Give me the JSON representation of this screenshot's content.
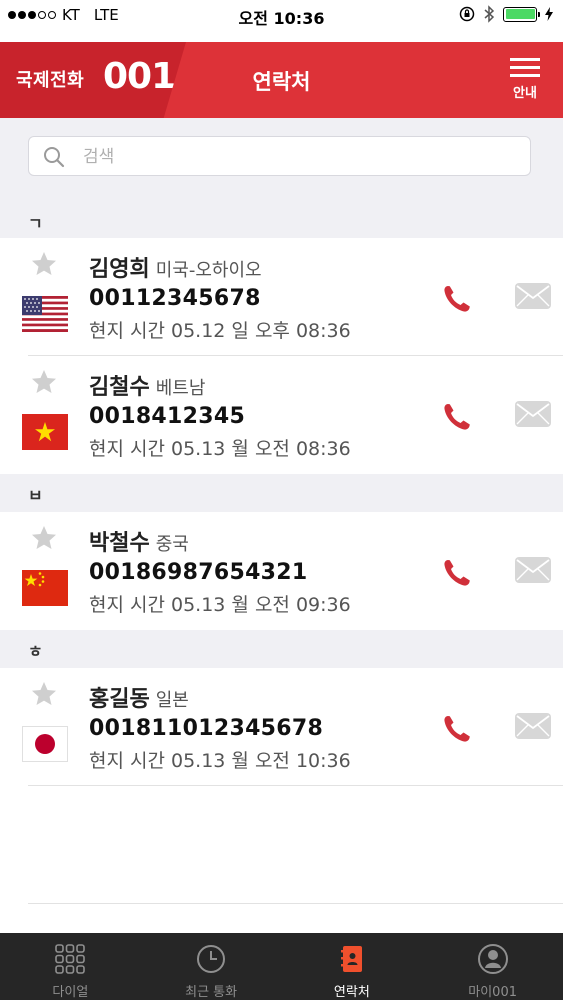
{
  "status_bar": {
    "carrier": "KT",
    "network": "LTE",
    "time": "오전 10:36"
  },
  "header": {
    "brand_text": "국제전화",
    "brand_number": "001",
    "title": "연락처",
    "menu_label": "안내"
  },
  "search": {
    "placeholder": "검색"
  },
  "sections": [
    {
      "label": "ㄱ"
    },
    {
      "label": "ㅂ"
    },
    {
      "label": "ㅎ"
    }
  ],
  "contacts": [
    {
      "name": "김영희",
      "country": "미국-오하이오",
      "number": "00112345678",
      "local_time": "현지 시간 05.12 일 오후 08:36",
      "flag": "usa-flag"
    },
    {
      "name": "김철수",
      "country": "베트남",
      "number": "0018412345",
      "local_time": "현지 시간 05.13 월 오전 08:36",
      "flag": "vietnam-flag"
    },
    {
      "name": "박철수",
      "country": "중국",
      "number": "00186987654321",
      "local_time": "현지 시간 05.13 월 오전 09:36",
      "flag": "china-flag"
    },
    {
      "name": "홍길동",
      "country": "일본",
      "number": "001811012345678",
      "local_time": "현지 시간 05.13 월 오전 10:36",
      "flag": "japan-flag"
    }
  ],
  "tabs": [
    {
      "label": "다이얼",
      "icon": "dialpad-icon",
      "active": false
    },
    {
      "label": "최근 통화",
      "icon": "clock-icon",
      "active": false
    },
    {
      "label": "연락처",
      "icon": "contacts-book-icon",
      "active": true
    },
    {
      "label": "마이001",
      "icon": "profile-icon",
      "active": false
    }
  ],
  "colors": {
    "header_red": "#dd3238",
    "brand_red": "#c8232c",
    "call_red": "#d0303a",
    "active_tab_orange": "#f0502d",
    "tab_bar": "#262626",
    "battery_green": "#4cd964"
  }
}
